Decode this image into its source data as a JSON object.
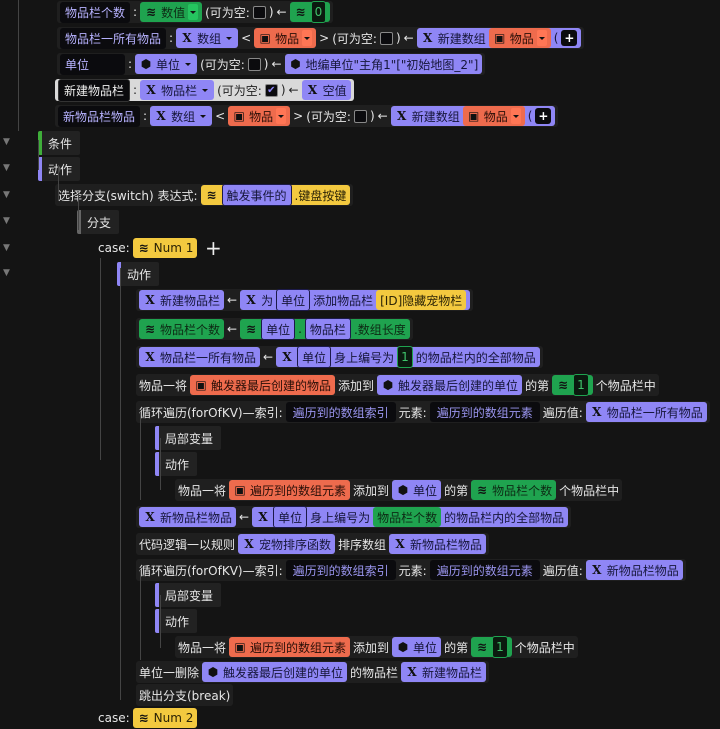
{
  "rows": [
    {
      "kind": "expr",
      "segs": [
        {
          "t": "lbl",
          "text": "物品栏个数"
        },
        {
          "t": "txt",
          "text": ":"
        },
        {
          "t": "chip",
          "c": "g",
          "icon": "frog-icon",
          "text": "数值",
          "dd": true
        },
        {
          "t": "txt",
          "text": "(可为空:"
        },
        {
          "t": "chk",
          "checked": false
        },
        {
          "t": "txt",
          "text": ")"
        },
        {
          "t": "txt",
          "text": "←"
        },
        {
          "t": "chip",
          "c": "g",
          "icon": "frog-icon",
          "kids": [
            {
              "t": "chip",
              "c": "dk",
              "text": "0"
            }
          ]
        }
      ]
    },
    {
      "kind": "expr",
      "segs": [
        {
          "t": "lbl",
          "text": "物品栏一所有物品"
        },
        {
          "t": "txt",
          "text": ":"
        },
        {
          "t": "chip",
          "c": "p",
          "icon": "x-icon",
          "text": "数组",
          "dd": true
        },
        {
          "t": "txt",
          "text": "<"
        },
        {
          "t": "chip",
          "c": "o",
          "icon": "box-icon",
          "text": "物品",
          "dd": true
        },
        {
          "t": "txt",
          "text": ">"
        },
        {
          "t": "txt",
          "text": "(可为空:"
        },
        {
          "t": "chk",
          "checked": false
        },
        {
          "t": "txt",
          "text": ")"
        },
        {
          "t": "txt",
          "text": "←"
        },
        {
          "t": "chip",
          "c": "p",
          "icon": "x-icon",
          "text": "新建数组",
          "kids": [
            {
              "t": "chip",
              "c": "o",
              "icon": "box-icon",
              "text": "物品",
              "dd": true
            },
            {
              "t": "txt",
              "text": "("
            },
            {
              "t": "plus"
            }
          ]
        }
      ]
    },
    {
      "kind": "expr",
      "segs": [
        {
          "t": "lbl",
          "w": true,
          "text": "单位"
        },
        {
          "t": "txt",
          "text": ":"
        },
        {
          "t": "chip",
          "c": "p",
          "icon": "cube-icon",
          "text": "单位",
          "dd": true
        },
        {
          "t": "txt",
          "text": "(可为空:"
        },
        {
          "t": "chk",
          "checked": false
        },
        {
          "t": "txt",
          "text": ")"
        },
        {
          "t": "txt",
          "text": "←"
        },
        {
          "t": "chip",
          "c": "p",
          "icon": "cube-icon",
          "text": "地编单位\"主角1\"[\"初始地图_2\"]"
        }
      ]
    },
    {
      "kind": "hl",
      "segs": [
        {
          "t": "lbl",
          "text": "新建物品栏"
        },
        {
          "t": "txt",
          "text": ":"
        },
        {
          "t": "chip",
          "c": "p",
          "icon": "x-icon",
          "text": "物品栏",
          "dd": true
        },
        {
          "t": "txt",
          "text": "(可为空:"
        },
        {
          "t": "chk",
          "checked": true
        },
        {
          "t": "txt",
          "text": ")"
        },
        {
          "t": "txt",
          "text": "←"
        },
        {
          "t": "chip",
          "c": "p",
          "icon": "x-icon",
          "text": "空值"
        }
      ]
    },
    {
      "kind": "expr",
      "segs": [
        {
          "t": "lbl",
          "text": "新物品栏物品"
        },
        {
          "t": "txt",
          "text": ":"
        },
        {
          "t": "chip",
          "c": "p",
          "icon": "x-icon",
          "text": "数组",
          "dd": true
        },
        {
          "t": "txt",
          "text": "<"
        },
        {
          "t": "chip",
          "c": "o",
          "icon": "box-icon",
          "text": "物品",
          "dd": true
        },
        {
          "t": "txt",
          "text": ">"
        },
        {
          "t": "txt",
          "text": "(可为空:"
        },
        {
          "t": "chk",
          "checked": false
        },
        {
          "t": "txt",
          "text": ")"
        },
        {
          "t": "txt",
          "text": "←"
        },
        {
          "t": "chip",
          "c": "p",
          "icon": "x-icon",
          "text": "新建数组",
          "kids": [
            {
              "t": "chip",
              "c": "o",
              "icon": "box-icon",
              "text": "物品",
              "dd": true
            },
            {
              "t": "txt",
              "text": "("
            },
            {
              "t": "plus"
            }
          ]
        }
      ]
    },
    {
      "kind": "bar",
      "color": "g",
      "segs": [
        {
          "t": "txt",
          "text": "条件"
        }
      ]
    },
    {
      "kind": "bar",
      "color": "p",
      "segs": [
        {
          "t": "txt",
          "text": "动作"
        }
      ]
    },
    {
      "kind": "expr",
      "segs": [
        {
          "t": "txt",
          "text": "选择分支(switch) 表达式:"
        },
        {
          "t": "chip",
          "c": "y",
          "icon": "frog-icon",
          "kids": [
            {
              "t": "chip",
              "c": "in",
              "text": "触发事件的"
            },
            {
              "t": "txt",
              "text": ".键盘按键"
            }
          ]
        }
      ]
    },
    {
      "kind": "bar",
      "color": "gray",
      "segs": [
        {
          "t": "txt",
          "text": "分支"
        }
      ]
    },
    {
      "kind": "expr",
      "segs": [
        {
          "t": "txt",
          "text": "case:"
        },
        {
          "t": "chip",
          "c": "y",
          "icon": "frog-icon",
          "text": "Num 1"
        }
      ]
    },
    {
      "kind": "bar",
      "color": "p",
      "segs": [
        {
          "t": "txt",
          "text": "动作"
        }
      ]
    },
    {
      "kind": "expr",
      "segs": [
        {
          "t": "chip",
          "c": "p",
          "icon": "x-icon",
          "text": "新建物品栏"
        },
        {
          "t": "txt",
          "text": "←"
        },
        {
          "t": "chip",
          "c": "p",
          "icon": "x-icon",
          "text": "为",
          "kids": [
            {
              "t": "chip",
              "c": "in",
              "text": "单位"
            },
            {
              "t": "txt",
              "text": "添加物品栏"
            },
            {
              "t": "chip",
              "c": "y",
              "text": "[ID]隐藏宠物栏"
            }
          ]
        }
      ]
    },
    {
      "kind": "expr",
      "segs": [
        {
          "t": "chip",
          "c": "g",
          "icon": "frog-icon",
          "text": "物品栏个数"
        },
        {
          "t": "txt",
          "text": "←"
        },
        {
          "t": "chip",
          "c": "g",
          "icon": "frog-icon",
          "kids": [
            {
              "t": "chip",
              "c": "in",
              "text": "单位"
            },
            {
              "t": "txt",
              "text": "."
            },
            {
              "t": "chip",
              "c": "in",
              "text": "物品栏"
            },
            {
              "t": "txt",
              "text": ".数组长度"
            }
          ]
        }
      ]
    },
    {
      "kind": "expr",
      "segs": [
        {
          "t": "chip",
          "c": "p",
          "icon": "x-icon",
          "text": "物品栏一所有物品"
        },
        {
          "t": "txt",
          "text": "←"
        },
        {
          "t": "chip",
          "c": "p",
          "icon": "x-icon",
          "kids": [
            {
              "t": "chip",
              "c": "in",
              "text": "单位"
            },
            {
              "t": "txt",
              "text": "身上编号为"
            },
            {
              "t": "chip",
              "c": "dk",
              "text": "1"
            },
            {
              "t": "txt",
              "text": "的物品栏内的全部物品"
            }
          ]
        }
      ]
    },
    {
      "kind": "expr",
      "segs": [
        {
          "t": "txt",
          "text": "物品一将"
        },
        {
          "t": "chip",
          "c": "o",
          "icon": "box-icon",
          "text": "触发器最后创建的物品"
        },
        {
          "t": "txt",
          "text": "添加到"
        },
        {
          "t": "chip",
          "c": "p",
          "icon": "cube-icon",
          "text": "触发器最后创建的单位"
        },
        {
          "t": "txt",
          "text": "的第"
        },
        {
          "t": "chip",
          "c": "g",
          "icon": "frog-icon",
          "kids": [
            {
              "t": "chip",
              "c": "dk",
              "text": "1"
            }
          ]
        },
        {
          "t": "txt",
          "text": "个物品栏中"
        }
      ]
    },
    {
      "kind": "expr",
      "segs": [
        {
          "t": "txt",
          "text": "循环遍历(forOfKV)—索引:"
        },
        {
          "t": "chip",
          "c": "d",
          "text": "遍历到的数组索引"
        },
        {
          "t": "txt",
          "text": "元素:"
        },
        {
          "t": "chip",
          "c": "d",
          "text": "遍历到的数组元素"
        },
        {
          "t": "txt",
          "text": "遍历值:"
        },
        {
          "t": "chip",
          "c": "p",
          "icon": "x-icon",
          "text": "物品栏一所有物品"
        }
      ]
    },
    {
      "kind": "bar",
      "color": "p",
      "segs": [
        {
          "t": "txt",
          "text": "局部变量"
        }
      ]
    },
    {
      "kind": "bar",
      "color": "p",
      "segs": [
        {
          "t": "txt",
          "text": "动作"
        }
      ]
    },
    {
      "kind": "expr",
      "segs": [
        {
          "t": "txt",
          "text": "物品一将"
        },
        {
          "t": "chip",
          "c": "o",
          "icon": "box-icon",
          "text": "遍历到的数组元素"
        },
        {
          "t": "txt",
          "text": "添加到"
        },
        {
          "t": "chip",
          "c": "p",
          "icon": "cube-icon",
          "text": "单位"
        },
        {
          "t": "txt",
          "text": "的第"
        },
        {
          "t": "chip",
          "c": "g",
          "icon": "frog-icon",
          "text": "物品栏个数"
        },
        {
          "t": "txt",
          "text": "个物品栏中"
        }
      ]
    },
    {
      "kind": "expr",
      "segs": [
        {
          "t": "chip",
          "c": "p",
          "icon": "x-icon",
          "text": "新物品栏物品"
        },
        {
          "t": "txt",
          "text": "←"
        },
        {
          "t": "chip",
          "c": "p",
          "icon": "x-icon",
          "kids": [
            {
              "t": "chip",
              "c": "in",
              "text": "单位"
            },
            {
              "t": "txt",
              "text": "身上编号为"
            },
            {
              "t": "chip",
              "c": "g",
              "text": "物品栏个数"
            },
            {
              "t": "txt",
              "text": "的物品栏内的全部物品"
            }
          ]
        }
      ]
    },
    {
      "kind": "expr",
      "segs": [
        {
          "t": "txt",
          "text": "代码逻辑一以规则"
        },
        {
          "t": "chip",
          "c": "p",
          "icon": "x-icon",
          "text": "宠物排序函数"
        },
        {
          "t": "txt",
          "text": "排序数组"
        },
        {
          "t": "chip",
          "c": "p",
          "icon": "x-icon",
          "text": "新物品栏物品"
        }
      ]
    },
    {
      "kind": "expr",
      "segs": [
        {
          "t": "txt",
          "text": "循环遍历(forOfKV)—索引:"
        },
        {
          "t": "chip",
          "c": "d",
          "text": "遍历到的数组索引"
        },
        {
          "t": "txt",
          "text": "元素:"
        },
        {
          "t": "chip",
          "c": "d",
          "text": "遍历到的数组元素"
        },
        {
          "t": "txt",
          "text": "遍历值:"
        },
        {
          "t": "chip",
          "c": "p",
          "icon": "x-icon",
          "text": "新物品栏物品"
        }
      ]
    },
    {
      "kind": "bar",
      "color": "p",
      "segs": [
        {
          "t": "txt",
          "text": "局部变量"
        }
      ]
    },
    {
      "kind": "bar",
      "color": "p",
      "segs": [
        {
          "t": "txt",
          "text": "动作"
        }
      ]
    },
    {
      "kind": "expr",
      "segs": [
        {
          "t": "txt",
          "text": "物品一将"
        },
        {
          "t": "chip",
          "c": "o",
          "icon": "box-icon",
          "text": "遍历到的数组元素"
        },
        {
          "t": "txt",
          "text": "添加到"
        },
        {
          "t": "chip",
          "c": "p",
          "icon": "cube-icon",
          "text": "单位"
        },
        {
          "t": "txt",
          "text": "的第"
        },
        {
          "t": "chip",
          "c": "g",
          "icon": "frog-icon",
          "kids": [
            {
              "t": "chip",
              "c": "dk",
              "text": "1"
            }
          ]
        },
        {
          "t": "txt",
          "text": "个物品栏中"
        }
      ]
    },
    {
      "kind": "expr",
      "segs": [
        {
          "t": "txt",
          "text": "单位一删除"
        },
        {
          "t": "chip",
          "c": "p",
          "icon": "cube-icon",
          "text": "触发器最后创建的单位"
        },
        {
          "t": "txt",
          "text": "的物品栏"
        },
        {
          "t": "chip",
          "c": "p",
          "icon": "x-icon",
          "text": "新建物品栏"
        }
      ]
    },
    {
      "kind": "expr",
      "segs": [
        {
          "t": "txt",
          "text": "跳出分支(break)"
        }
      ]
    },
    {
      "kind": "expr",
      "segs": [
        {
          "t": "txt",
          "text": "case:"
        },
        {
          "t": "chip",
          "c": "y",
          "icon": "frog-icon",
          "text": "Num 2"
        }
      ]
    }
  ],
  "add_case_label": "+",
  "colors": {
    "purple": "#8f86f5",
    "green": "#1fa34f",
    "orange": "#ee6b4d",
    "yellow": "#f3c93f"
  }
}
